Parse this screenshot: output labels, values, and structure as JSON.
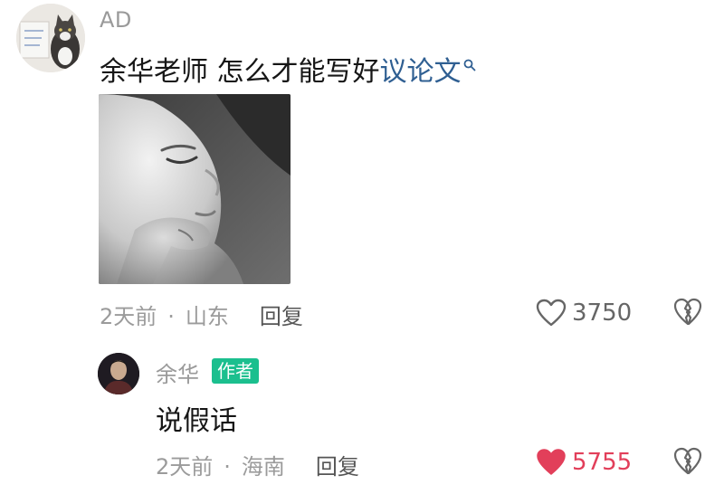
{
  "comment": {
    "username": "AD",
    "text_prefix": "余华老师 怎么才能写好",
    "search_link": "议论文",
    "meta": {
      "time": "2天前",
      "separator": "·",
      "location": "山东",
      "reply_label": "回复"
    },
    "likes": "3750",
    "liked": false
  },
  "reply": {
    "username": "余华",
    "badge": "作者",
    "text": "说假话",
    "meta": {
      "time": "2天前",
      "separator": "·",
      "location": "海南",
      "reply_label": "回复"
    },
    "likes": "5755",
    "liked": true
  },
  "colors": {
    "accent_badge": "#1bbf8e",
    "link": "#2f5f92",
    "liked_heart": "#e23f5a",
    "meta_gray": "#9b9b9b"
  },
  "icons": {
    "search": "search-icon",
    "like": "heart-icon",
    "liked": "heart-filled-icon",
    "dislike": "broken-heart-icon"
  }
}
